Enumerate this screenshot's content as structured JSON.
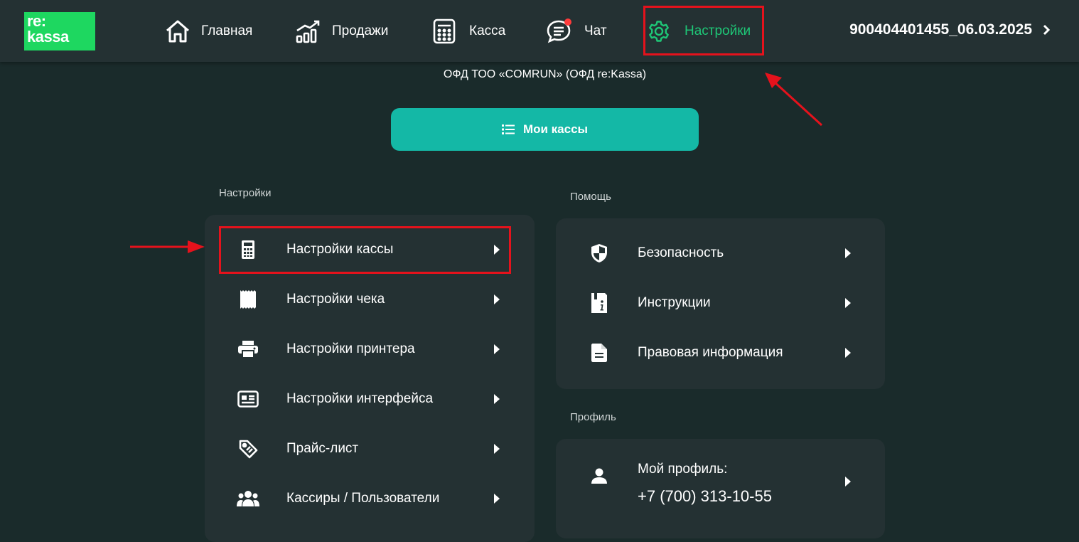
{
  "logo": {
    "line1": "re:",
    "line2": "kassa"
  },
  "nav": [
    {
      "label": "Главная",
      "icon": "home-icon"
    },
    {
      "label": "Продажи",
      "icon": "sales-chart-icon"
    },
    {
      "label": "Касса",
      "icon": "calculator-icon"
    },
    {
      "label": "Чат",
      "icon": "chat-icon"
    },
    {
      "label": "Настройки",
      "icon": "gear-icon",
      "active": true
    }
  ],
  "account": {
    "label": "900404401455_06.03.2025",
    "icon": "chevron-right-icon"
  },
  "ofd_text": "ОФД ТОО «COMRUN» (ОФД re:Kassa)",
  "my_registers_button": {
    "label": "Мои кассы",
    "icon": "list-icon"
  },
  "settings_section": {
    "title": "Настройки",
    "items": [
      {
        "label": "Настройки кассы",
        "icon": "calculator-icon"
      },
      {
        "label": "Настройки чека",
        "icon": "receipt-icon"
      },
      {
        "label": "Настройки принтера",
        "icon": "printer-icon"
      },
      {
        "label": "Настройки интерфейса",
        "icon": "interface-icon"
      },
      {
        "label": "Прайс-лист",
        "icon": "tag-icon"
      },
      {
        "label": "Кассиры / Пользователи",
        "icon": "users-icon"
      }
    ]
  },
  "help_section": {
    "title": "Помощь",
    "items": [
      {
        "label": "Безопасность",
        "icon": "shield-icon"
      },
      {
        "label": "Инструкции",
        "icon": "info-book-icon"
      },
      {
        "label": "Правовая информация",
        "icon": "document-icon"
      }
    ]
  },
  "profile_section": {
    "title": "Профиль",
    "label": "Мой профиль:",
    "phone": "+7 (700) 313-10-55",
    "icon": "person-icon"
  },
  "colors": {
    "background": "#1a2b2b",
    "panel": "#243133",
    "accent": "#14b8a6",
    "active_nav": "#1ec777",
    "highlight": "#e5121c",
    "logo": "#1ed760"
  }
}
